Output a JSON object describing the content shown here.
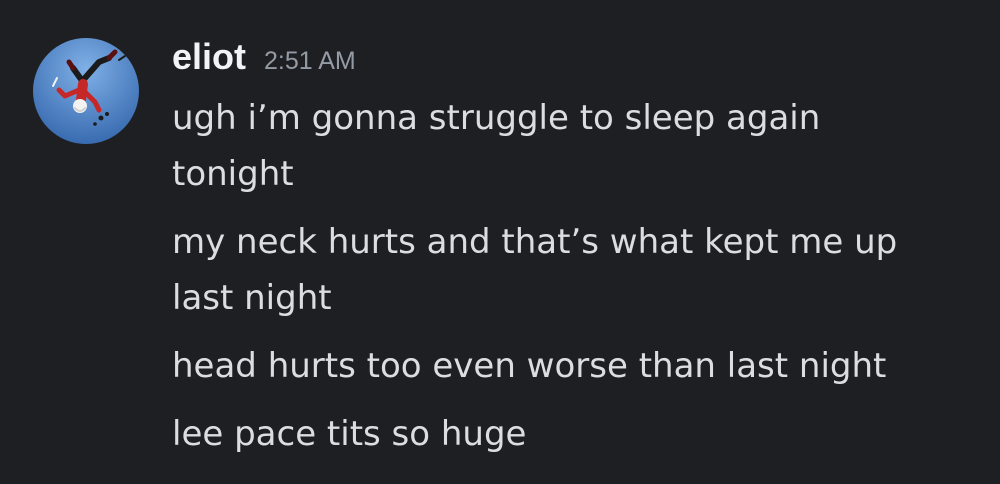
{
  "author": {
    "username": "eliot",
    "timestamp": "2:51 AM",
    "avatar_icon": "avatar-falling-figure-icon",
    "avatar_bg": "#3d6fb5"
  },
  "messages": [
    {
      "lines": [
        "ugh i’m gonna struggle to sleep again",
        "tonight"
      ]
    },
    {
      "lines": [
        "my neck hurts and that’s what kept me up",
        "last night"
      ]
    },
    {
      "lines": [
        "head hurts too even worse than last night"
      ]
    },
    {
      "lines": [
        "lee pace tits so huge"
      ]
    }
  ],
  "colors": {
    "background": "#1e1f22",
    "username": "#f2f3f5",
    "text": "#dbdee1",
    "timestamp": "#949ba4"
  }
}
